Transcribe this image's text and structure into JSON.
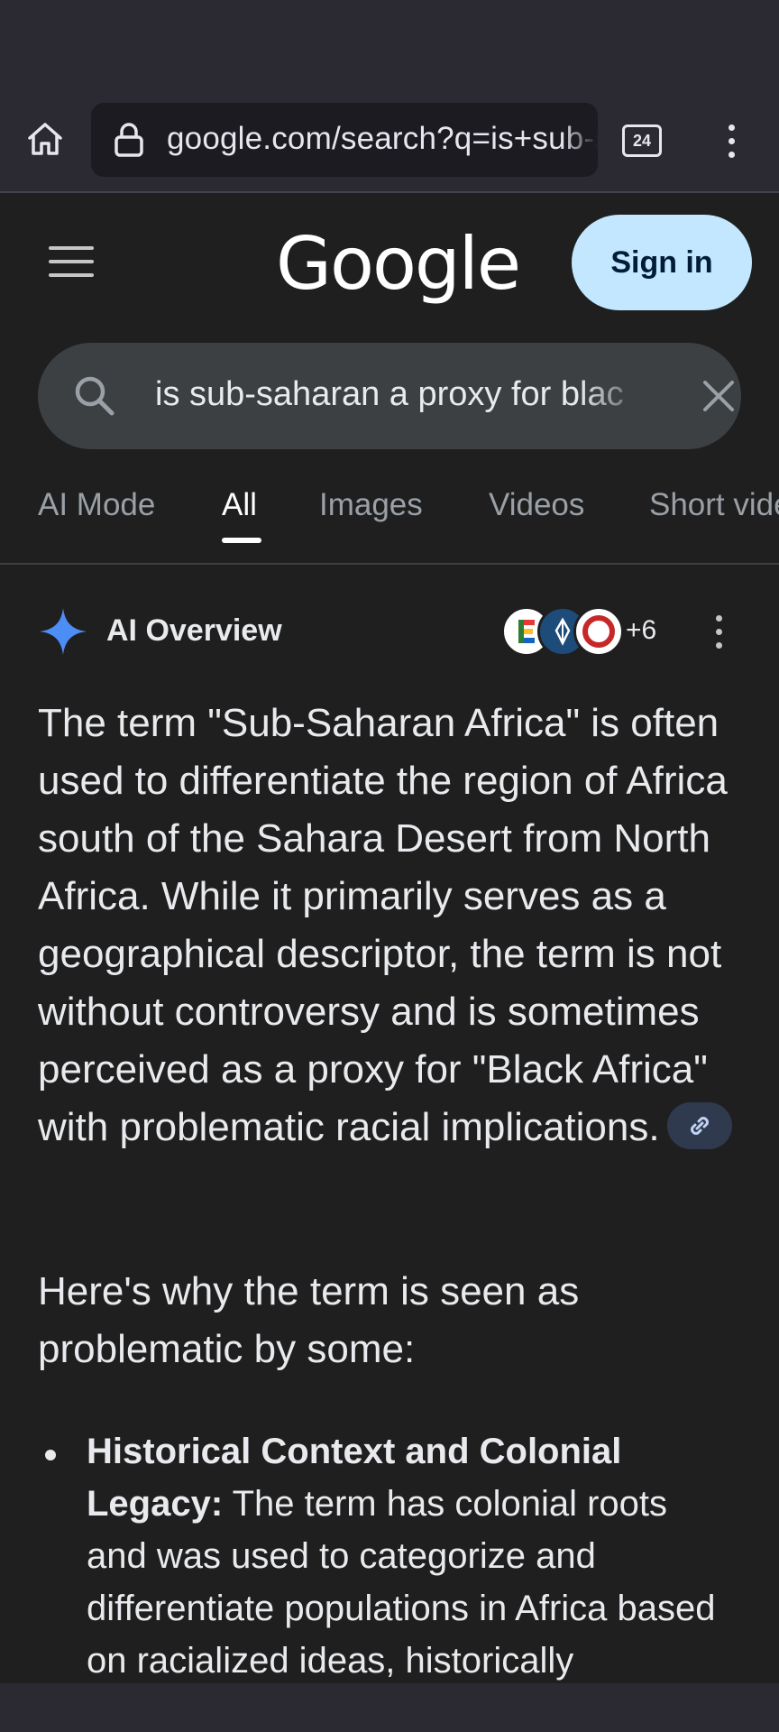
{
  "browser": {
    "url": "google.com/search?q=is+sub-saharan+a+proxy+for+black",
    "tab_count": "24"
  },
  "header": {
    "logo": "Google",
    "signin_label": "Sign in"
  },
  "search": {
    "query": "is sub-saharan a proxy for black"
  },
  "tabs": [
    {
      "label": "AI Mode"
    },
    {
      "label": "All",
      "active": true
    },
    {
      "label": "Images"
    },
    {
      "label": "Videos"
    },
    {
      "label": "Short videos"
    }
  ],
  "ai_overview": {
    "title": "AI Overview",
    "sources_more": "+6",
    "paragraph": "The term \"Sub-Saharan Africa\" is often used to differentiate the region of Africa south of the Sahara Desert from North Africa. While it primarily serves as a geographical descriptor, the term is not without controversy and is sometimes perceived as a proxy for \"Black Africa\" with problematic racial implications.",
    "subheading": "Here's why the term is seen as problematic by some:",
    "bullets": [
      {
        "title": "Historical Context and Colonial Legacy:",
        "text": " The term has colonial roots and was used to categorize and differentiate populations in Africa based on racialized ideas, historically"
      }
    ]
  },
  "icons": {
    "home": "home-icon",
    "lock": "lock-icon",
    "tabs": "tab-switcher-icon",
    "menu": "more-vert-icon",
    "hamburger": "menu-icon",
    "search": "search-icon",
    "clear": "close-icon",
    "ai": "sparkle-icon",
    "link": "link-icon"
  },
  "colors": {
    "background": "#1f1f1f",
    "chrome": "#2b2a33",
    "signin_bg": "#c2e7ff",
    "search_bg": "#3c4043",
    "link_chip": "#303a4e",
    "ai_star": "#4c8df6"
  }
}
